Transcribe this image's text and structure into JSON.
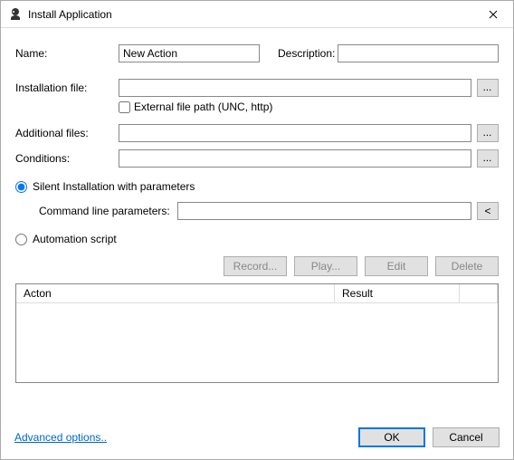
{
  "window": {
    "title": "Install Application"
  },
  "labels": {
    "name": "Name:",
    "description": "Description:",
    "installation_file": "Installation file:",
    "additional_files": "Additional files:",
    "conditions": "Conditions:",
    "external_file": "External file path (UNC, http)",
    "silent": "Silent Installation with parameters",
    "command_line": "Command line parameters:",
    "automation": "Automation script",
    "advanced": "Advanced options.."
  },
  "values": {
    "name": "New Action",
    "description": "",
    "installation_file": "",
    "additional_files": "",
    "conditions": "",
    "command_line": "",
    "external_file_checked": false,
    "silent_selected": true,
    "automation_selected": false
  },
  "buttons": {
    "browse": "...",
    "lt": "<",
    "record": "Record...",
    "play": "Play...",
    "edit": "Edit",
    "delete": "Delete",
    "ok": "OK",
    "cancel": "Cancel"
  },
  "table": {
    "columns": {
      "action": "Acton",
      "result": "Result"
    },
    "rows": []
  }
}
